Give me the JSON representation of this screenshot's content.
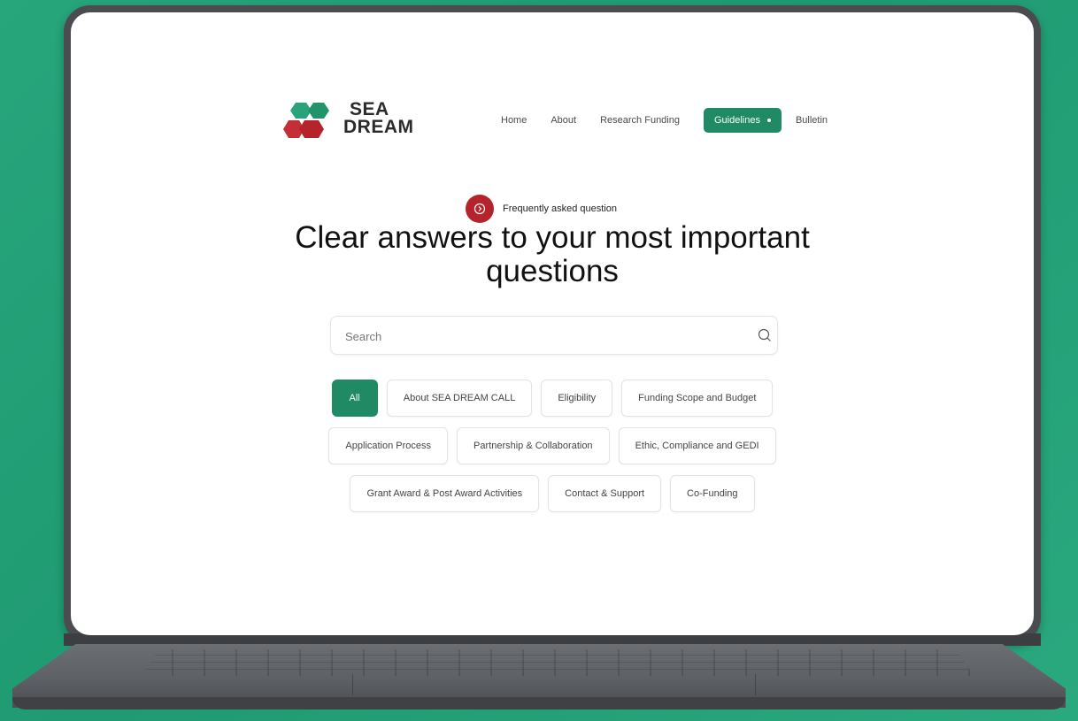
{
  "brand": {
    "line1": "SEA",
    "line2": "DREAM",
    "colors": {
      "green": "#2aa37a",
      "red": "#c42e35"
    }
  },
  "nav": {
    "items": [
      {
        "label": "Home",
        "active": false
      },
      {
        "label": "About",
        "active": false
      },
      {
        "label": "Research Funding",
        "active": false
      },
      {
        "label": "Guidelines",
        "active": true
      },
      {
        "label": "Bulletin",
        "active": false
      }
    ]
  },
  "hero": {
    "badge_label": "Frequently asked question",
    "title_line1": "Clear answers to your most important",
    "title_line2": "questions"
  },
  "search": {
    "placeholder": "Search",
    "value": "",
    "icon": "search-icon"
  },
  "filters": {
    "row1": [
      "All",
      "About SEA DREAM CALL",
      "Eligibility",
      "Funding Scope and Budget"
    ],
    "row2": [
      "Application Process",
      "Partnership & Collaboration",
      "Ethic, Compliance and GEDI"
    ],
    "row3": [
      "Grant Award & Post Award Activities",
      "Contact & Support",
      "Co-Funding"
    ],
    "selected": "All"
  },
  "theme": {
    "accent": "#1f8a64",
    "badge": "#b5242b",
    "background": "#27a57b"
  }
}
